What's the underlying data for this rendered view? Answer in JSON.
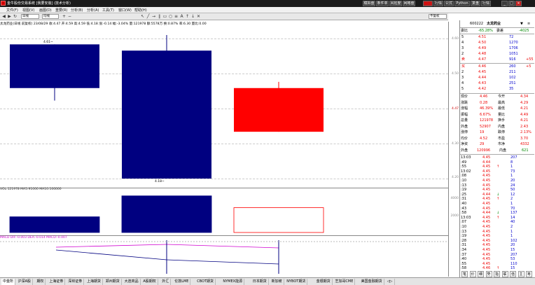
{
  "titlebar": {
    "title": "金牛股份交易系统  [我要安装]  (技术分析)",
    "buttons": [
      "模拟盘",
      "条件单",
      "风险度",
      "网格盘",
      "股东",
      "行情",
      "公式",
      "Python",
      "复盘",
      "行情"
    ],
    "active_button": "股东"
  },
  "menu": [
    "文件(F)",
    "视图(V)",
    "画图(D)",
    "重要(R)",
    "分析(B)",
    "分析(A)",
    "工具(T)",
    "窗口(W)",
    "帮助(H)"
  ],
  "toolbar": {
    "period_select": "日线",
    "indicator_select": "均线",
    "right_select": "不复权"
  },
  "chart": {
    "info_line": "太龙药业(日线 前复权)  23/08/29  收:4.47  开:4.59  高:4.59  低:4.18  涨:-0.14  幅:-3.04%  量:121978  额:5578万  换:0.87%  率:6.30  量比:0.00",
    "price_labels": [
      "4.60",
      "4.50",
      "4.40",
      "4.30",
      "4.20"
    ],
    "label_top": "4.61~",
    "label_bottom": "4.18~",
    "current_price": "4.47",
    "vol_info": "VOL:121978  MA5:91000  MA10:100000",
    "vol_labels": [
      "VOL",
      "4000",
      "2000"
    ],
    "ind_info": "MACD  DIF:-0.003  DEA:-0.014  MACD:-0.007",
    "chart_data": {
      "type": "candlestick",
      "candles": [
        {
          "open": 4.61,
          "close": 4.47,
          "high": 4.61,
          "low": 4.43,
          "color": "down"
        },
        {
          "open": 4.59,
          "close": 4.18,
          "high": 4.64,
          "low": 4.18,
          "color": "down"
        },
        {
          "open": 4.47,
          "close": 4.33,
          "high": 4.49,
          "low": 4.33,
          "color": "up"
        }
      ],
      "volumes": [
        1200,
        2800,
        1900
      ],
      "ylim": [
        4.18,
        4.64
      ]
    }
  },
  "quote": {
    "code": "600222",
    "name": "太龙药业",
    "weibi_label": "委比",
    "weibi": "-65.28%",
    "weicha_label": "委差",
    "weicha": "-4025",
    "asks": [
      {
        "lvl": "5",
        "price": "4.51",
        "vol": "72"
      },
      {
        "lvl": "4",
        "price": "4.50",
        "vol": "1270"
      },
      {
        "lvl": "3",
        "price": "4.49",
        "vol": "1706"
      },
      {
        "lvl": "2",
        "price": "4.48",
        "vol": "1051"
      },
      {
        "lvl": "卖",
        "price": "4.47",
        "vol": "916",
        "extra": "+55"
      }
    ],
    "bids": [
      {
        "lvl": "买",
        "price": "4.46",
        "vol": "260",
        "extra": "+5"
      },
      {
        "lvl": "2",
        "price": "4.45",
        "vol": "211"
      },
      {
        "lvl": "3",
        "price": "4.44",
        "vol": "102"
      },
      {
        "lvl": "4",
        "price": "4.43",
        "vol": "251"
      },
      {
        "lvl": "5",
        "price": "4.42",
        "vol": "35"
      }
    ],
    "stats": [
      [
        "现价",
        "4.46",
        "今开",
        "4.34"
      ],
      [
        "涨跌",
        "0.28",
        "最高",
        "4.29"
      ],
      [
        "涨幅",
        "46.39%",
        "最低",
        "4.21"
      ],
      [
        "振幅",
        "6.67%",
        "量比",
        "4.49"
      ],
      [
        "总量",
        "121978",
        "换手",
        "4.21"
      ],
      [
        "外盘",
        "52907",
        "内盘",
        "2.43"
      ],
      [
        "涨停",
        "19",
        "跌停",
        "2.13%"
      ],
      [
        "均价",
        "4.52",
        "市盈",
        "3.70"
      ],
      [
        "净资",
        "29",
        "市净",
        "4332"
      ]
    ],
    "total_label": "外盘",
    "total": "120996",
    "inner_label": "内盘",
    "inner": "621",
    "ticks": [
      {
        "t": "13:03",
        "p": "4.45",
        "v": "207",
        "d": ""
      },
      {
        "t": ":49",
        "p": "4.44",
        "v": "8",
        "d": ""
      },
      {
        "t": ":55",
        "p": "4.45",
        "v": "1",
        "d": "↑"
      },
      {
        "t": "13:02",
        "p": "4.45",
        "v": "73",
        "d": ""
      },
      {
        "t": ":08",
        "p": "4.45",
        "v": "1",
        "d": ""
      },
      {
        "t": ":10",
        "p": "4.45",
        "v": "20",
        "d": ""
      },
      {
        "t": ":13",
        "p": "4.45",
        "v": "24",
        "d": ""
      },
      {
        "t": ":19",
        "p": "4.45",
        "v": "50",
        "d": ""
      },
      {
        "t": ":25",
        "p": "4.44",
        "v": "12",
        "d": "↓"
      },
      {
        "t": ":31",
        "p": "4.45",
        "v": "2",
        "d": "↑"
      },
      {
        "t": ":40",
        "p": "4.45",
        "v": "1",
        "d": ""
      },
      {
        "t": ":43",
        "p": "4.45",
        "v": "70",
        "d": ""
      },
      {
        "t": ":58",
        "p": "4.44",
        "v": "137",
        "d": "↓"
      },
      {
        "t": "13:03",
        "p": "4.45",
        "v": "14",
        "d": "↑"
      },
      {
        "t": ":07",
        "p": "4.45",
        "v": "40",
        "d": ""
      },
      {
        "t": ":10",
        "p": "4.45",
        "v": "2",
        "d": ""
      },
      {
        "t": ":13",
        "p": "4.45",
        "v": "1",
        "d": ""
      },
      {
        "t": ":19",
        "p": "4.45",
        "v": "1",
        "d": ""
      },
      {
        "t": ":28",
        "p": "4.45",
        "v": "102",
        "d": ""
      },
      {
        "t": ":31",
        "p": "4.45",
        "v": "20",
        "d": ""
      },
      {
        "t": ":34",
        "p": "4.45",
        "v": "15",
        "d": ""
      },
      {
        "t": ":37",
        "p": "4.45",
        "v": "207",
        "d": ""
      },
      {
        "t": ":40",
        "p": "4.45",
        "v": "53",
        "d": ""
      },
      {
        "t": ":55",
        "p": "4.45",
        "v": "110",
        "d": ""
      },
      {
        "t": ":58",
        "p": "4.46",
        "v": "15",
        "d": "↑"
      }
    ],
    "bottom_tabs": [
      "笔",
      "价",
      "细",
      "势",
      "指",
      "联",
      "值",
      "主",
      "筹"
    ]
  },
  "tabs": [
    "中金所",
    "沪深A股",
    "期权",
    "上海证券",
    "深圳证券",
    "上海期货",
    "郑州期货",
    "大连商品",
    "A股期权",
    "外汇",
    "伦敦LME",
    "CBOT期货",
    "NYMEX能源",
    "日本期货",
    "新加坡",
    "NYBOT期货",
    "金银期货",
    "芝加哥CME",
    "美国金融期货",
    "◁▷"
  ],
  "active_tab": "中金所"
}
